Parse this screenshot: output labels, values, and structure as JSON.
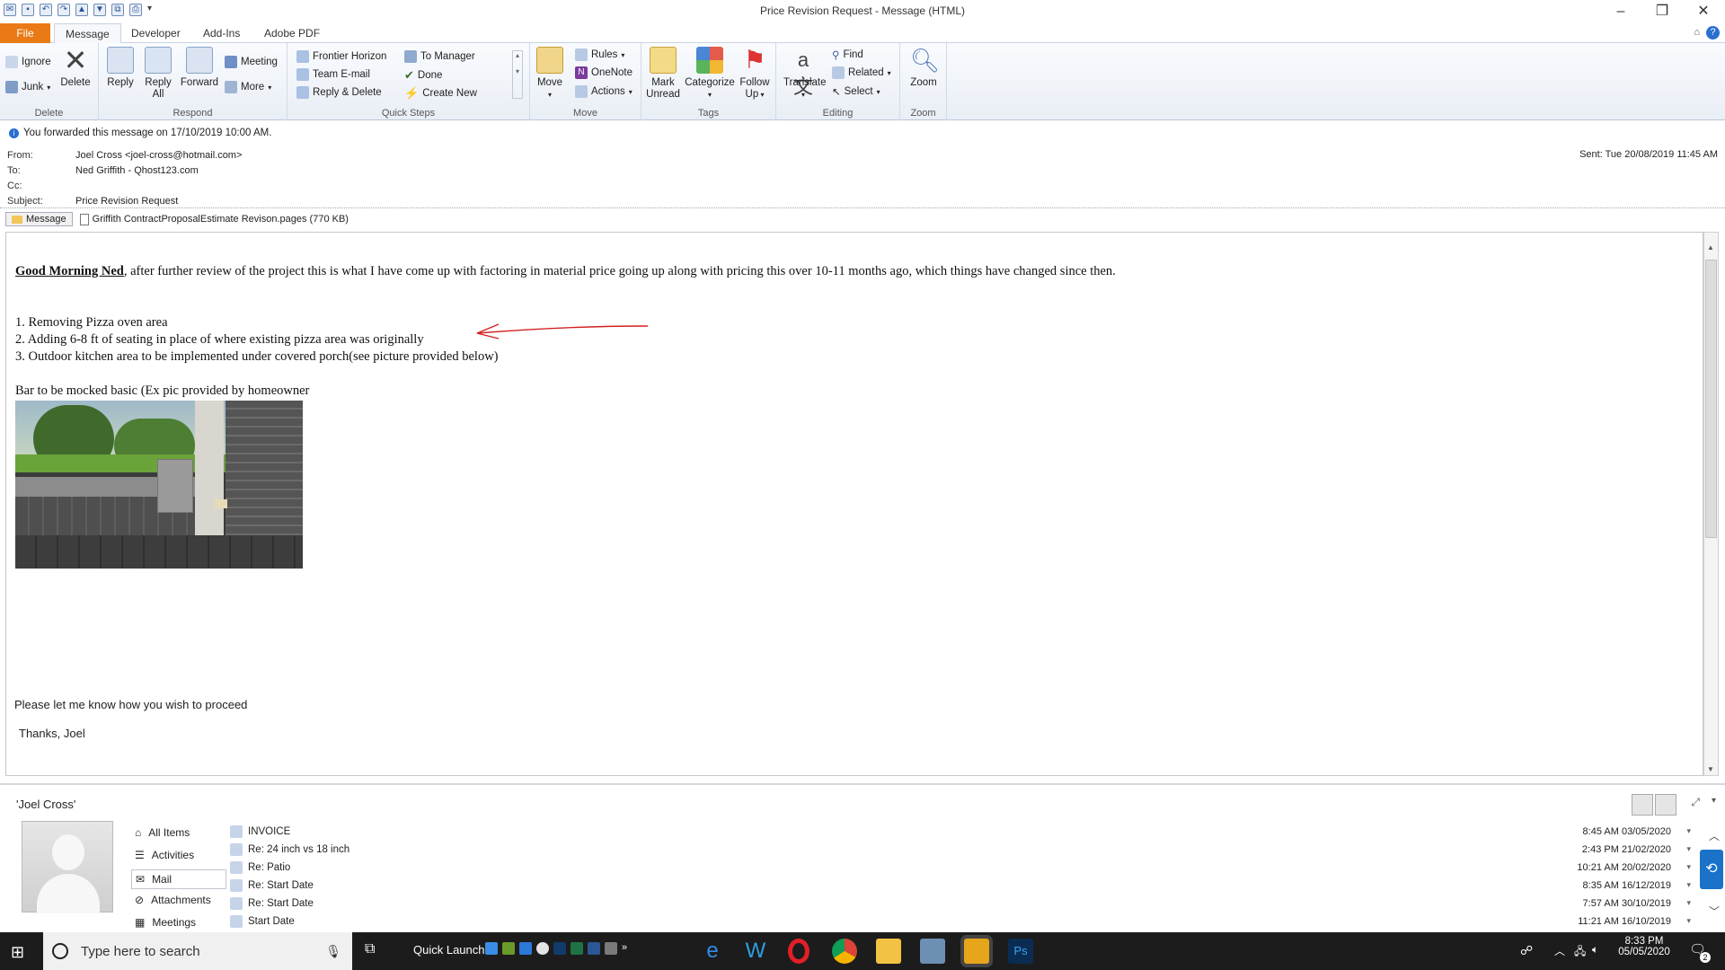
{
  "window": {
    "title": "Price Revision Request  -  Message (HTML)"
  },
  "tabs": [
    "File",
    "Message",
    "Developer",
    "Add-Ins",
    "Adobe PDF"
  ],
  "ribbon": {
    "delete_group": {
      "label": "Delete",
      "ignore": "Ignore",
      "junk": "Junk",
      "delete": "Delete"
    },
    "respond_group": {
      "label": "Respond",
      "reply": "Reply",
      "reply_all_1": "Reply",
      "reply_all_2": "All",
      "forward": "Forward",
      "meeting": "Meeting",
      "more": "More"
    },
    "quicksteps_group": {
      "label": "Quick Steps",
      "items": [
        "Frontier Horizon",
        "Team E-mail",
        "Reply & Delete",
        "To Manager",
        "Done",
        "Create New"
      ]
    },
    "move_group": {
      "label": "Move",
      "move": "Move",
      "rules": "Rules",
      "onenote": "OneNote",
      "actions": "Actions"
    },
    "tags_group": {
      "label": "Tags",
      "mark_unread_1": "Mark",
      "mark_unread_2": "Unread",
      "categorize": "Categorize",
      "follow_up_1": "Follow",
      "follow_up_2": "Up"
    },
    "editing_group": {
      "label": "Editing",
      "translate": "Translate",
      "find": "Find",
      "related": "Related",
      "select": "Select"
    },
    "zoom_group": {
      "label": "Zoom",
      "zoom": "Zoom"
    }
  },
  "header": {
    "info": "You forwarded this message on 17/10/2019 10:00 AM.",
    "from_label": "From:",
    "from": "Joel Cross <joel-cross@hotmail.com>",
    "to_label": "To:",
    "to": "Ned Griffith - Qhost123.com",
    "cc_label": "Cc:",
    "subject_label": "Subject:",
    "subject": "Price Revision Request",
    "sent": "Sent:   Tue 20/08/2019 11:45 AM"
  },
  "attachments": {
    "message_tab": "Message",
    "file": "Griffith ContractProposalEstimate Revison.pages (770 KB)"
  },
  "body": {
    "greeting_bold": "Good Morning Ned",
    "greeting_rest": ", after further review of the project this is what I have come up with factoring in material price going up along with pricing this over 10-11 months ago, which things have changed since then.",
    "list": [
      "1. Removing Pizza oven area",
      "2. Adding 6-8 ft of seating in place of where existing pizza area was originally",
      "3. Outdoor kitchen area to be implemented under covered porch(see picture provided below)"
    ],
    "bar_note": "Bar to be mocked basic (Ex pic provided by homeowner",
    "closing": "Please let me know how you wish to proceed",
    "signature": "Thanks, Joel"
  },
  "people_pane": {
    "name": "'Joel Cross'",
    "nav": [
      "All Items",
      "Activities",
      "Mail",
      "Attachments",
      "Meetings"
    ],
    "mails": [
      {
        "subject": "INVOICE",
        "date": "8:45 AM  03/05/2020"
      },
      {
        "subject": "Re: 24 inch vs 18 inch",
        "date": "2:43 PM  21/02/2020"
      },
      {
        "subject": "Re: Patio",
        "date": "10:21 AM  20/02/2020"
      },
      {
        "subject": "Re: Start Date",
        "date": "8:35 AM  16/12/2019"
      },
      {
        "subject": "Re: Start Date",
        "date": "7:57 AM  30/10/2019"
      },
      {
        "subject": "Start Date",
        "date": "11:21 AM  16/10/2019"
      }
    ]
  },
  "taskbar": {
    "search_placeholder": "Type here to search",
    "quick_launch": "Quick Launch",
    "time": "8:33 PM",
    "date": "05/05/2020",
    "notif_count": "2"
  }
}
